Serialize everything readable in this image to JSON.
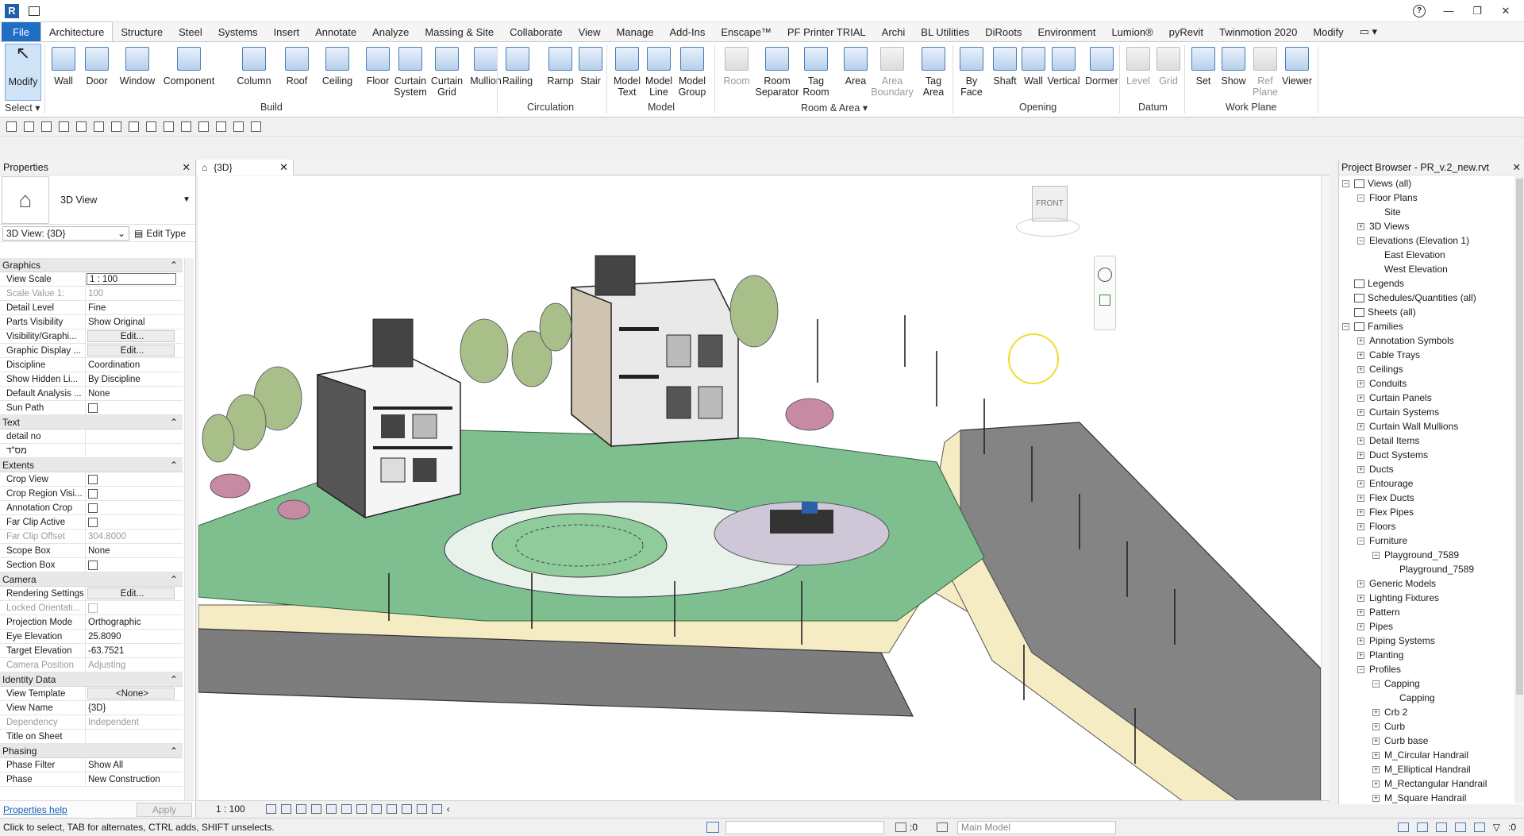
{
  "titlebar": {
    "app_letter": "R",
    "help": "?"
  },
  "tabs": [
    "File",
    "Architecture",
    "Structure",
    "Steel",
    "Systems",
    "Insert",
    "Annotate",
    "Analyze",
    "Massing & Site",
    "Collaborate",
    "View",
    "Manage",
    "Add-Ins",
    "Enscape™",
    "PF Printer TRIAL",
    "Archi",
    "BL Utilities",
    "DiRoots",
    "Environment",
    "Lumion®",
    "pyRevit",
    "Twinmotion 2020",
    "Modify"
  ],
  "active_tab": "Architecture",
  "ribbon": {
    "modify": "Modify",
    "build": [
      "Wall",
      "Door",
      "Window",
      "Component",
      "Column",
      "Roof",
      "Ceiling",
      "Floor",
      "Curtain\nSystem",
      "Curtain\nGrid",
      "Mullion"
    ],
    "circulation": [
      "Railing",
      "Ramp",
      "Stair"
    ],
    "model": [
      "Model\nText",
      "Model\nLine",
      "Model\nGroup"
    ],
    "room_area": [
      "Room",
      "Room\nSeparator",
      "Tag\nRoom",
      "Area",
      "Area\nBoundary",
      "Tag\nArea"
    ],
    "opening": [
      "By\nFace",
      "Shaft",
      "Wall",
      "Vertical",
      "Dormer"
    ],
    "datum": [
      "Level",
      "Grid"
    ],
    "work_plane": [
      "Set",
      "Show",
      "Ref\nPlane",
      "Viewer"
    ],
    "groups": {
      "select": "Select ▾",
      "build": "Build",
      "circulation": "Circulation",
      "model": "Model",
      "room_area": "Room & Area ▾",
      "opening": "Opening",
      "datum": "Datum",
      "work_plane": "Work Plane"
    }
  },
  "properties": {
    "title": "Properties",
    "type_name": "3D View",
    "selector": "3D View: {3D}",
    "edit_type": "Edit Type",
    "sections": [
      {
        "name": "Graphics",
        "rows": [
          {
            "k": "View Scale",
            "v": "1 : 100",
            "kind": "input"
          },
          {
            "k": "Scale Value    1:",
            "v": "100",
            "kind": "grey"
          },
          {
            "k": "Detail Level",
            "v": "Fine"
          },
          {
            "k": "Parts Visibility",
            "v": "Show Original"
          },
          {
            "k": "Visibility/Graphi...",
            "v": "Edit...",
            "kind": "btn"
          },
          {
            "k": "Graphic Display ...",
            "v": "Edit...",
            "kind": "btn"
          },
          {
            "k": "Discipline",
            "v": "Coordination"
          },
          {
            "k": "Show Hidden Li...",
            "v": "By Discipline"
          },
          {
            "k": "Default Analysis ...",
            "v": "None"
          },
          {
            "k": "Sun Path",
            "v": "",
            "kind": "cb"
          }
        ]
      },
      {
        "name": "Text",
        "rows": [
          {
            "k": "detail no",
            "v": ""
          },
          {
            "k": "מס\"ד",
            "v": ""
          }
        ]
      },
      {
        "name": "Extents",
        "rows": [
          {
            "k": "Crop View",
            "v": "",
            "kind": "cb"
          },
          {
            "k": "Crop Region Visi...",
            "v": "",
            "kind": "cb"
          },
          {
            "k": "Annotation Crop",
            "v": "",
            "kind": "cb"
          },
          {
            "k": "Far Clip Active",
            "v": "",
            "kind": "cb"
          },
          {
            "k": "Far Clip Offset",
            "v": "304.8000",
            "kind": "grey"
          },
          {
            "k": "Scope Box",
            "v": "None"
          },
          {
            "k": "Section Box",
            "v": "",
            "kind": "cb"
          }
        ]
      },
      {
        "name": "Camera",
        "rows": [
          {
            "k": "Rendering Settings",
            "v": "Edit...",
            "kind": "btn"
          },
          {
            "k": "Locked Orientati...",
            "v": "",
            "kind": "greycb"
          },
          {
            "k": "Projection Mode",
            "v": "Orthographic"
          },
          {
            "k": "Eye Elevation",
            "v": "25.8090"
          },
          {
            "k": "Target Elevation",
            "v": "-63.7521"
          },
          {
            "k": "Camera Position",
            "v": "Adjusting",
            "kind": "grey"
          }
        ]
      },
      {
        "name": "Identity Data",
        "rows": [
          {
            "k": "View Template",
            "v": "<None>",
            "kind": "btn"
          },
          {
            "k": "View Name",
            "v": "{3D}"
          },
          {
            "k": "Dependency",
            "v": "Independent",
            "kind": "grey"
          },
          {
            "k": "Title on Sheet",
            "v": ""
          }
        ]
      },
      {
        "name": "Phasing",
        "rows": [
          {
            "k": "Phase Filter",
            "v": "Show All"
          },
          {
            "k": "Phase",
            "v": "New Construction"
          }
        ]
      }
    ],
    "help": "Properties help",
    "apply": "Apply"
  },
  "view": {
    "tab": "{3D}",
    "scale": "1 : 100",
    "viewcube": "FRONT"
  },
  "browser": {
    "title": "Project Browser - PR_v.2_new.rvt",
    "nodes": [
      {
        "t": "Views (all)",
        "l": 0,
        "e": "-",
        "i": 1
      },
      {
        "t": "Floor Plans",
        "l": 1,
        "e": "-"
      },
      {
        "t": "Site",
        "l": 2,
        "e": ""
      },
      {
        "t": "3D Views",
        "l": 1,
        "e": "+"
      },
      {
        "t": "Elevations (Elevation 1)",
        "l": 1,
        "e": "-"
      },
      {
        "t": "East Elevation",
        "l": 2,
        "e": ""
      },
      {
        "t": "West Elevation",
        "l": 2,
        "e": ""
      },
      {
        "t": "Legends",
        "l": 0,
        "e": "",
        "i": 1
      },
      {
        "t": "Schedules/Quantities (all)",
        "l": 0,
        "e": "",
        "i": 1
      },
      {
        "t": "Sheets (all)",
        "l": 0,
        "e": "",
        "i": 1
      },
      {
        "t": "Families",
        "l": 0,
        "e": "-",
        "i": 1
      },
      {
        "t": "Annotation Symbols",
        "l": 1,
        "e": "+"
      },
      {
        "t": "Cable Trays",
        "l": 1,
        "e": "+"
      },
      {
        "t": "Ceilings",
        "l": 1,
        "e": "+"
      },
      {
        "t": "Conduits",
        "l": 1,
        "e": "+"
      },
      {
        "t": "Curtain Panels",
        "l": 1,
        "e": "+"
      },
      {
        "t": "Curtain Systems",
        "l": 1,
        "e": "+"
      },
      {
        "t": "Curtain Wall Mullions",
        "l": 1,
        "e": "+"
      },
      {
        "t": "Detail Items",
        "l": 1,
        "e": "+"
      },
      {
        "t": "Duct Systems",
        "l": 1,
        "e": "+"
      },
      {
        "t": "Ducts",
        "l": 1,
        "e": "+"
      },
      {
        "t": "Entourage",
        "l": 1,
        "e": "+"
      },
      {
        "t": "Flex Ducts",
        "l": 1,
        "e": "+"
      },
      {
        "t": "Flex Pipes",
        "l": 1,
        "e": "+"
      },
      {
        "t": "Floors",
        "l": 1,
        "e": "+"
      },
      {
        "t": "Furniture",
        "l": 1,
        "e": "-"
      },
      {
        "t": "Playground_7589",
        "l": 2,
        "e": "-"
      },
      {
        "t": "Playground_7589",
        "l": 3,
        "e": ""
      },
      {
        "t": "Generic Models",
        "l": 1,
        "e": "+"
      },
      {
        "t": "Lighting Fixtures",
        "l": 1,
        "e": "+"
      },
      {
        "t": "Pattern",
        "l": 1,
        "e": "+"
      },
      {
        "t": "Pipes",
        "l": 1,
        "e": "+"
      },
      {
        "t": "Piping Systems",
        "l": 1,
        "e": "+"
      },
      {
        "t": "Planting",
        "l": 1,
        "e": "+"
      },
      {
        "t": "Profiles",
        "l": 1,
        "e": "-"
      },
      {
        "t": "Capping",
        "l": 2,
        "e": "-"
      },
      {
        "t": "Capping",
        "l": 3,
        "e": ""
      },
      {
        "t": "Crb 2",
        "l": 2,
        "e": "+"
      },
      {
        "t": "Curb",
        "l": 2,
        "e": "+"
      },
      {
        "t": "Curb base",
        "l": 2,
        "e": "+"
      },
      {
        "t": "M_Circular Handrail",
        "l": 2,
        "e": "+"
      },
      {
        "t": "M_Elliptical Handrail",
        "l": 2,
        "e": "+"
      },
      {
        "t": "M_Rectangular Handrail",
        "l": 2,
        "e": "+"
      },
      {
        "t": "M_Square Handrail",
        "l": 2,
        "e": "+"
      }
    ]
  },
  "status": {
    "message": "Click to select, TAB for alternates, CTRL adds, SHIFT unselects.",
    "zero": ":0",
    "model": "Main Model",
    "filter": ":0"
  }
}
